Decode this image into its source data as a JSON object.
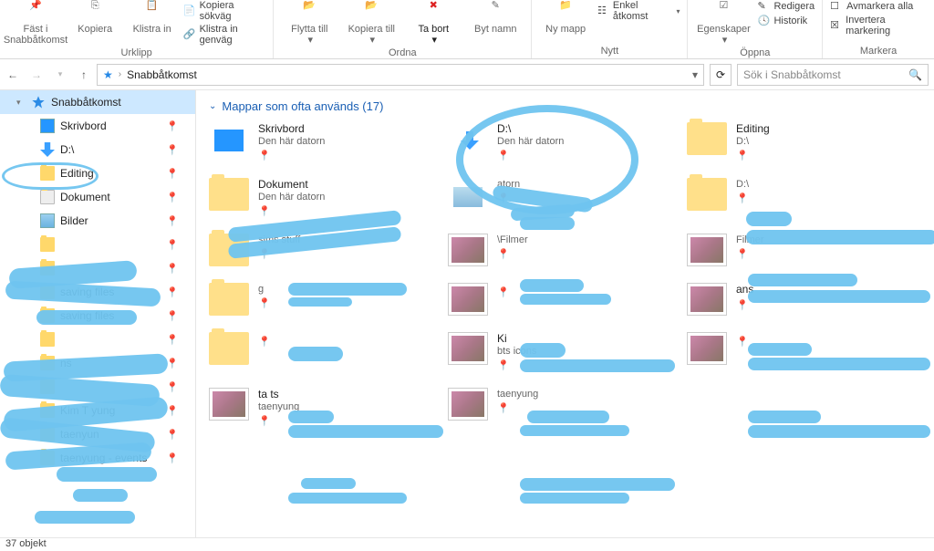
{
  "ribbon": {
    "clipboard": {
      "pin": "Fäst i\nSnabbåtkomst",
      "copy": "Kopiera",
      "paste": "Klistra\nin",
      "copy_path": "Kopiera sökväg",
      "paste_shortcut": "Klistra in genväg",
      "label": "Urklipp"
    },
    "organize": {
      "move": "Flytta\ntill",
      "copyto": "Kopiera\ntill",
      "delete": "Ta\nbort",
      "rename": "Byt\nnamn",
      "label": "Ordna"
    },
    "new": {
      "newfolder": "Ny\nmapp",
      "easy_access": "Enkel åtkomst",
      "label": "Nytt"
    },
    "open": {
      "properties": "Egenskaper",
      "edit": "Redigera",
      "history": "Historik",
      "label": "Öppna"
    },
    "select": {
      "deselect": "Avmarkera alla",
      "invert": "Invertera markering",
      "label": "Markera"
    }
  },
  "nav": {
    "location": "Snabbåtkomst",
    "search_placeholder": "Sök i Snabbåtkomst"
  },
  "sidebar": {
    "items": [
      {
        "label": "Snabbåtkomst",
        "type": "star",
        "active": true,
        "exp": "▾"
      },
      {
        "label": "Skrivbord",
        "type": "desktop",
        "pin": true,
        "lvl": 2
      },
      {
        "label": "D:\\",
        "type": "down",
        "pin": true,
        "lvl": 2
      },
      {
        "label": "Editing",
        "type": "folder",
        "pin": true,
        "lvl": 2
      },
      {
        "label": "Dokument",
        "type": "doc",
        "pin": true,
        "lvl": 2
      },
      {
        "label": "Bilder",
        "type": "pic",
        "pin": true,
        "lvl": 2
      },
      {
        "label": "",
        "type": "folder",
        "pin": true,
        "lvl": 2
      },
      {
        "label": "",
        "type": "folder",
        "pin": true,
        "lvl": 2
      },
      {
        "label": "saving files",
        "type": "folder",
        "pin": true,
        "lvl": 2
      },
      {
        "label": "saving files",
        "type": "folder",
        "pin": true,
        "lvl": 2
      },
      {
        "label": "",
        "type": "folder",
        "pin": true,
        "lvl": 2
      },
      {
        "label": "ns",
        "type": "folder",
        "pin": true,
        "lvl": 2
      },
      {
        "label": "",
        "type": "folder",
        "pin": true,
        "lvl": 2
      },
      {
        "label": "Kim T       yung",
        "type": "folder",
        "pin": true,
        "lvl": 2
      },
      {
        "label": "taenyun",
        "type": "folder",
        "pin": true,
        "lvl": 2
      },
      {
        "label": "taenyung - events",
        "type": "folder",
        "pin": true,
        "lvl": 2
      }
    ]
  },
  "main": {
    "section_title": "Mappar som ofta används (17)",
    "items": [
      {
        "name": "Skrivbord",
        "sub": "Den här datorn",
        "thumb": "desktop",
        "pin": true
      },
      {
        "name": "D:\\",
        "sub": "Den här datorn",
        "thumb": "dfolder",
        "pin": true
      },
      {
        "name": "Editing",
        "sub": "D:\\",
        "thumb": "folder",
        "pin": true
      },
      {
        "name": "Dokument",
        "sub": "Den här datorn",
        "thumb": "folder",
        "pin": true
      },
      {
        "name": "",
        "sub": "atorn",
        "thumb": "pic",
        "pin": true
      },
      {
        "name": "",
        "sub": "D:\\",
        "thumb": "folder",
        "pin": true
      },
      {
        "name": "",
        "sub": "sims stuff",
        "thumb": "folder",
        "pin": true
      },
      {
        "name": "",
        "sub": "\\Filmer",
        "thumb": "photo",
        "pin": true
      },
      {
        "name": "",
        "sub": "Filmer",
        "thumb": "photo",
        "pin": true
      },
      {
        "name": "",
        "sub": "g",
        "thumb": "folder",
        "pin": true
      },
      {
        "name": "",
        "sub": "",
        "thumb": "photo",
        "pin": true
      },
      {
        "name": "ans",
        "sub": "",
        "thumb": "photo",
        "pin": true
      },
      {
        "name": "",
        "sub": "",
        "thumb": "folder",
        "pin": true
      },
      {
        "name": "Ki",
        "sub": "bts icons",
        "thumb": "photo",
        "pin": true
      },
      {
        "name": "",
        "sub": "",
        "thumb": "photo",
        "pin": true
      },
      {
        "name": "ta              ts",
        "sub": "taenyung",
        "thumb": "photo",
        "pin": true
      },
      {
        "name": "",
        "sub": "taenyung",
        "thumb": "photo",
        "pin": true
      }
    ]
  },
  "status": {
    "text": "37 objekt"
  }
}
